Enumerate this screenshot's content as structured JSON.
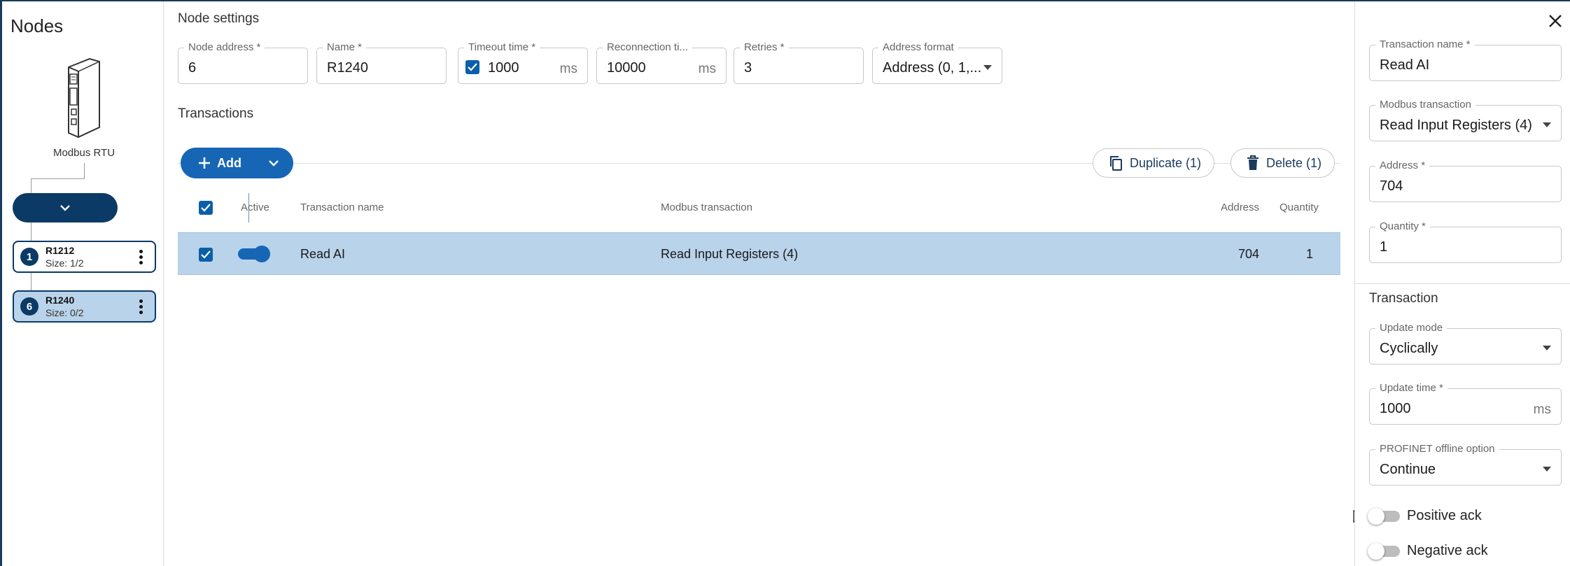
{
  "sidebar": {
    "title": "Nodes",
    "device_label": "Modbus RTU",
    "add_label": "Add",
    "nodes": [
      {
        "badge": "1",
        "name": "R1212",
        "size": "Size: 1/2"
      },
      {
        "badge": "6",
        "name": "R1240",
        "size": "Size: 0/2"
      }
    ]
  },
  "node_settings": {
    "title": "Node settings",
    "node_address": {
      "label": "Node address *",
      "value": "6"
    },
    "name": {
      "label": "Name *",
      "value": "R1240"
    },
    "timeout": {
      "label": "Timeout time *",
      "value": "1000",
      "unit": "ms"
    },
    "reconnection": {
      "label": "Reconnection ti...",
      "value": "10000",
      "unit": "ms"
    },
    "retries": {
      "label": "Retries *",
      "value": "3"
    },
    "address_format": {
      "label": "Address format",
      "value": "Address (0, 1,..."
    }
  },
  "transactions": {
    "title": "Transactions",
    "add_label": "Add",
    "duplicate_label": "Duplicate (1)",
    "delete_label": "Delete (1)",
    "headers": {
      "active": "Active",
      "name": "Transaction name",
      "modbus": "Modbus transaction",
      "address": "Address",
      "quantity": "Quantity"
    },
    "rows": [
      {
        "name": "Read AI",
        "modbus": "Read Input Registers (4)",
        "address": "704",
        "quantity": "1"
      }
    ]
  },
  "detail": {
    "transaction_name": {
      "label": "Transaction name *",
      "value": "Read AI"
    },
    "modbus_transaction": {
      "label": "Modbus transaction",
      "value": "Read Input Registers (4)"
    },
    "address": {
      "label": "Address *",
      "value": "704"
    },
    "quantity": {
      "label": "Quantity *",
      "value": "1"
    },
    "section_title": "Transaction",
    "update_mode": {
      "label": "Update mode",
      "value": "Cyclically"
    },
    "update_time": {
      "label": "Update time *",
      "value": "1000",
      "unit": "ms"
    },
    "profinet_offline": {
      "label": "PROFINET offline option",
      "value": "Continue"
    },
    "positive_ack": "Positive ack",
    "negative_ack": "Negative ack"
  },
  "colors": {
    "primary": "#1666b5",
    "dark_primary": "#0b3a66",
    "selected_row": "#b9d3ea"
  },
  "icons": [
    "device-icon",
    "plus-icon",
    "chevron-down-icon",
    "kebab-icon",
    "duplicate-icon",
    "trash-icon",
    "check-icon",
    "close-icon",
    "cursor-icon"
  ]
}
